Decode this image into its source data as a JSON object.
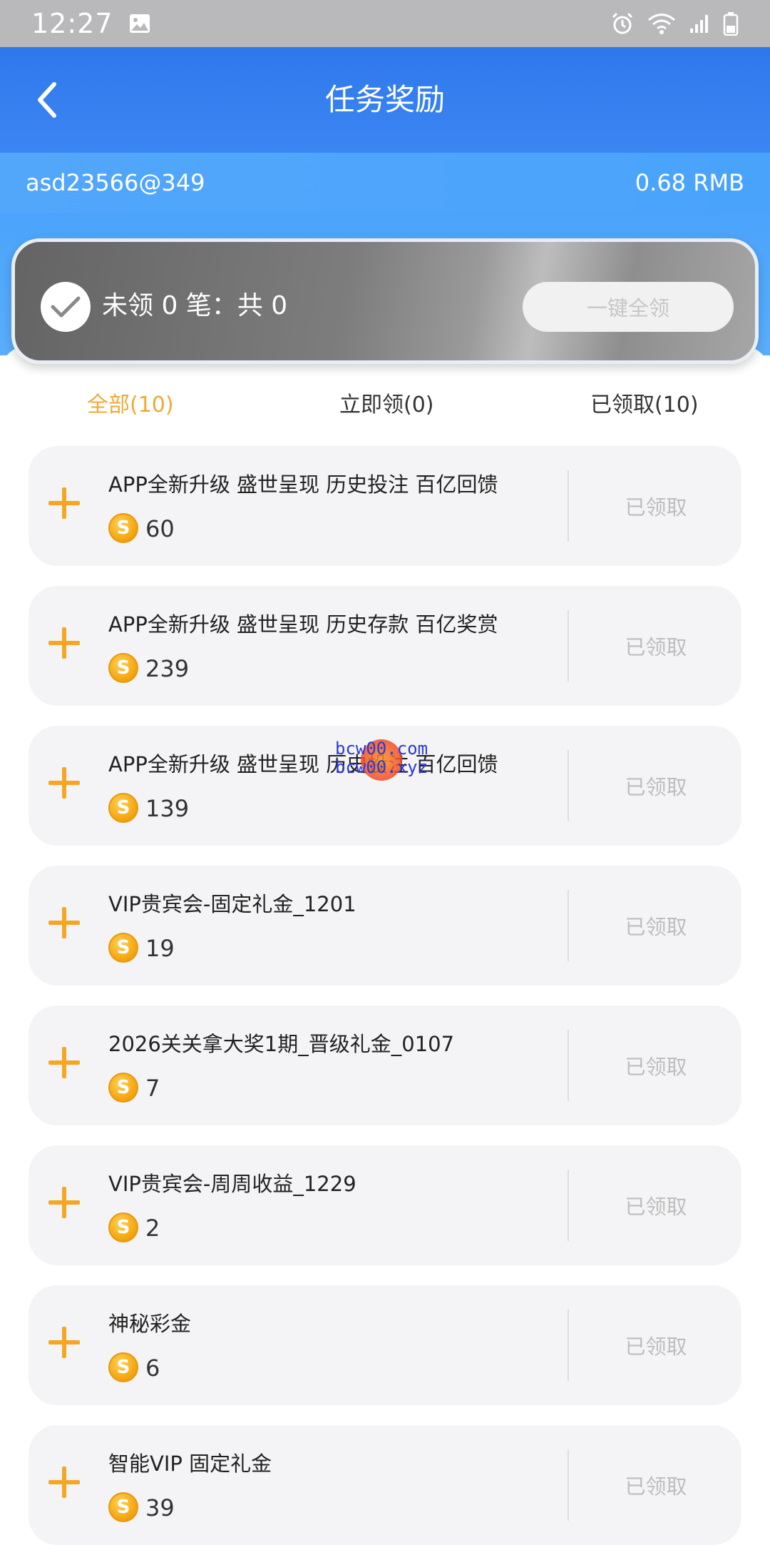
{
  "status_bar": {
    "time": "12:27",
    "icons": [
      "image-icon",
      "alarm-icon",
      "wifi-icon",
      "signal-icon",
      "battery-icon"
    ]
  },
  "header": {
    "title": "任务奖励"
  },
  "user": {
    "account": "asd23566@349",
    "balance": "0.68 RMB"
  },
  "claim_card": {
    "summary": "未领 0 笔：共 0",
    "claim_all_label": "一键全领"
  },
  "tabs": [
    {
      "label": "全部(10)",
      "active": true
    },
    {
      "label": "立即领(0)",
      "active": false
    },
    {
      "label": "已领取(10)",
      "active": false
    }
  ],
  "rewards": [
    {
      "name": "APP全新升级 盛世呈现 历史投注 百亿回馈",
      "amount": "60",
      "status": "已领取"
    },
    {
      "name": "APP全新升级 盛世呈现 历史存款 百亿奖赏",
      "amount": "239",
      "status": "已领取"
    },
    {
      "name": "APP全新升级 盛世呈现 历史投注 百亿回馈",
      "amount": "139",
      "status": "已领取"
    },
    {
      "name": "VIP贵宾会-固定礼金_1201",
      "amount": "19",
      "status": "已领取"
    },
    {
      "name": "2026关关拿大奖1期_晋级礼金_0107",
      "amount": "7",
      "status": "已领取"
    },
    {
      "name": "VIP贵宾会-周周收益_1229",
      "amount": "2",
      "status": "已领取"
    },
    {
      "name": "神秘彩金",
      "amount": "6",
      "status": "已领取"
    },
    {
      "name": "智能VIP 固定礼金",
      "amount": "39",
      "status": "已领取"
    }
  ],
  "coin_symbol": "S",
  "watermark": {
    "line1": "bcw00.com",
    "line2": "bcw00.xyz"
  },
  "colors": {
    "nav_blue": "#2f78ec",
    "user_bar_blue": "#52a7fb",
    "active_tab": "#f0a935",
    "plus_orange": "#f5a623",
    "coin_gold": "#f6a913"
  }
}
